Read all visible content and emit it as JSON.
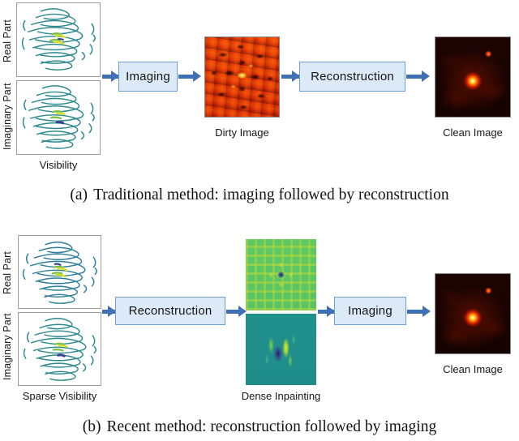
{
  "figure": {
    "panels": [
      {
        "id": "panel-a",
        "caption_label": "(a)",
        "caption_text": "Traditional method: imaging followed by reconstruction",
        "axis_labels": {
          "real": "Real Part",
          "imaginary": "Imaginary Part"
        },
        "input_label": "Visibility",
        "stage_labels": [
          "Imaging",
          "Reconstruction"
        ],
        "middle_label": "Dirty Image",
        "output_label": "Clean Image"
      },
      {
        "id": "panel-b",
        "caption_label": "(b)",
        "caption_text": "Recent method: reconstruction followed by imaging",
        "axis_labels": {
          "real": "Real Part",
          "imaginary": "Imaginary Part"
        },
        "input_label": "Sparse Visibility",
        "stage_labels": [
          "Reconstruction",
          "Imaging"
        ],
        "middle_label": "Dense Inpainting",
        "output_label": "Clean Image"
      }
    ]
  },
  "colors": {
    "arrow": "#3f6fb5",
    "process_box_fill": "#dce9f7",
    "process_box_border": "#6d9ed6",
    "panel_border": "#9d9d9d",
    "visibility_contour": "#2f8a8f",
    "visibility_highlight": "#d8e02a",
    "dirty_image_hot": "#ef3a08",
    "clean_image_core": "#ffe65a",
    "inpaint_real": "#5ec964",
    "inpaint_imag": "#21918c"
  },
  "icons": {
    "arrow_right": "arrow-right-icon"
  }
}
